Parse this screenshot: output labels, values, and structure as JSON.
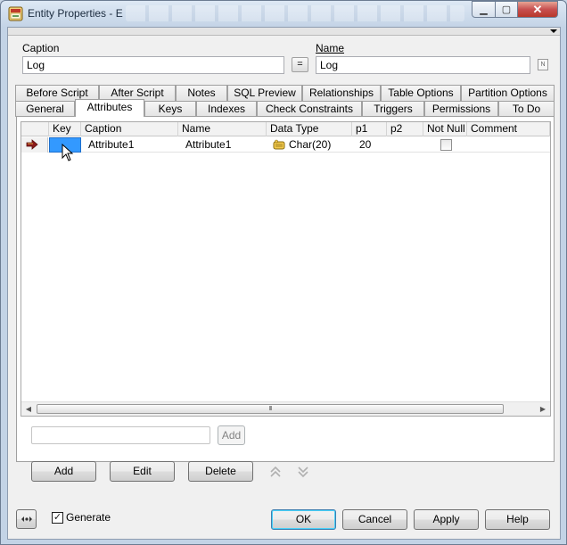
{
  "window": {
    "title": "Entity Properties - E",
    "window_buttons": {
      "minimize": "▁",
      "maximize": "▢",
      "close": "✕"
    }
  },
  "form": {
    "caption_label": "Caption",
    "caption_value": "Log",
    "equals_button": "=",
    "name_label": "Name",
    "name_value": "Log",
    "name_lock_icon": "N"
  },
  "tabs_row1": [
    "Before Script",
    "After Script",
    "Notes",
    "SQL Preview",
    "Relationships",
    "Table Options",
    "Partition Options"
  ],
  "tabs_row2": [
    "General",
    "Attributes",
    "Keys",
    "Indexes",
    "Check Constraints",
    "Triggers",
    "Permissions",
    "To Do"
  ],
  "active_tab": "Attributes",
  "grid": {
    "columns": [
      "Key",
      "Caption",
      "Name",
      "Data Type",
      "p1",
      "p2",
      "Not Null",
      "Comment"
    ],
    "rows": [
      {
        "key": "",
        "caption": "Attribute1",
        "name": "Attribute1",
        "data_type": "Char(20)",
        "p1": "20",
        "p2": "",
        "not_null": false,
        "comment": ""
      }
    ],
    "scroll_grip": "III"
  },
  "quick_add": {
    "value": "",
    "add_label": "Add"
  },
  "actions": {
    "add": "Add",
    "edit": "Edit",
    "delete": "Delete"
  },
  "footer": {
    "generate_label": "Generate",
    "generate_checked": true,
    "ok": "OK",
    "cancel": "Cancel",
    "apply": "Apply",
    "help": "Help"
  },
  "colors": {
    "key_cell_selected": "#3399ff",
    "row_indicator_arrow": "#8b1a1a",
    "close_button": "#c75050"
  },
  "icons": {
    "app": "entity-app-icon",
    "row_pointer": "row-pointer-arrow-icon",
    "data_type": "char-datatype-icon",
    "move_up": "move-up-icon",
    "move_down": "move-down-icon",
    "options": "options-icon"
  }
}
